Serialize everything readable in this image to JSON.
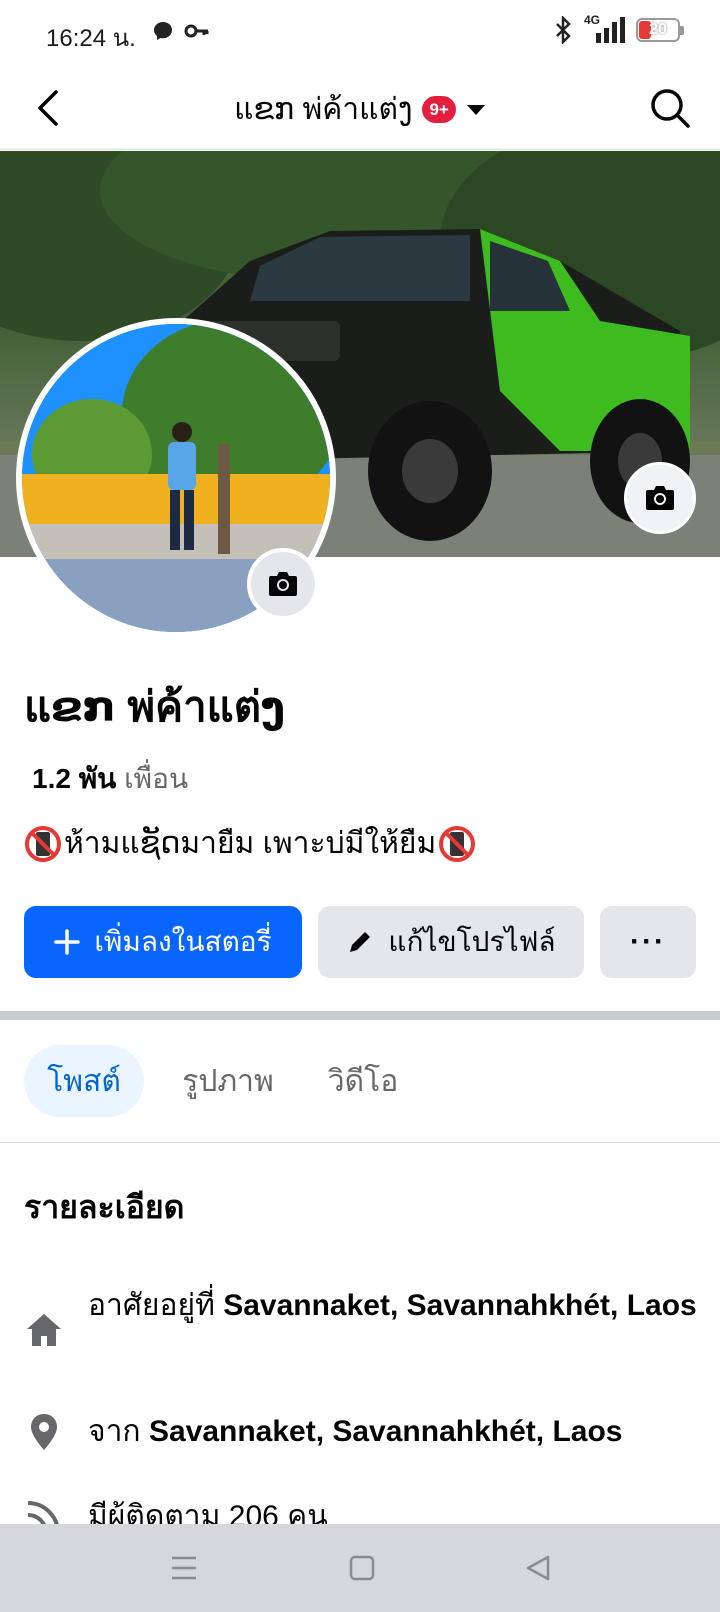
{
  "status_bar": {
    "time": "16:24 น.",
    "network": "4G",
    "battery": "20"
  },
  "header": {
    "title": "แຂກ พ่ค้าแต่ງ",
    "badge": "9+"
  },
  "profile": {
    "name": "แຂກ พ่ค้าแต่ງ",
    "friends_count": "1.2 พัน",
    "friends_label": "เพื่อน",
    "bio": "ห้ามแຊັດมายืม เพาะบ่มีให้ยืม"
  },
  "actions": {
    "add_story": "เพิ่มลงในสตอรี่",
    "edit_profile": "แก้ไขโปรไฟล์",
    "more": "···"
  },
  "tabs": [
    {
      "label": "โพสต์",
      "active": true
    },
    {
      "label": "รูปภาพ",
      "active": false
    },
    {
      "label": "วิดีโอ",
      "active": false
    }
  ],
  "details": {
    "title": "รายละเอียด",
    "lives_prefix": "อาศัยอยู่ที่",
    "lives_value": "Savannaket, Savannahkhét, Laos",
    "from_prefix": "จาก",
    "from_value": "Savannaket, Savannahkhét, Laos",
    "followers": "มีผู้ติดตาม 206 คน"
  },
  "colors": {
    "primary": "#0866ff",
    "badge": "#e41e3f",
    "tab_active_bg": "#ebf5ff",
    "tab_active_text": "#0064d1"
  }
}
